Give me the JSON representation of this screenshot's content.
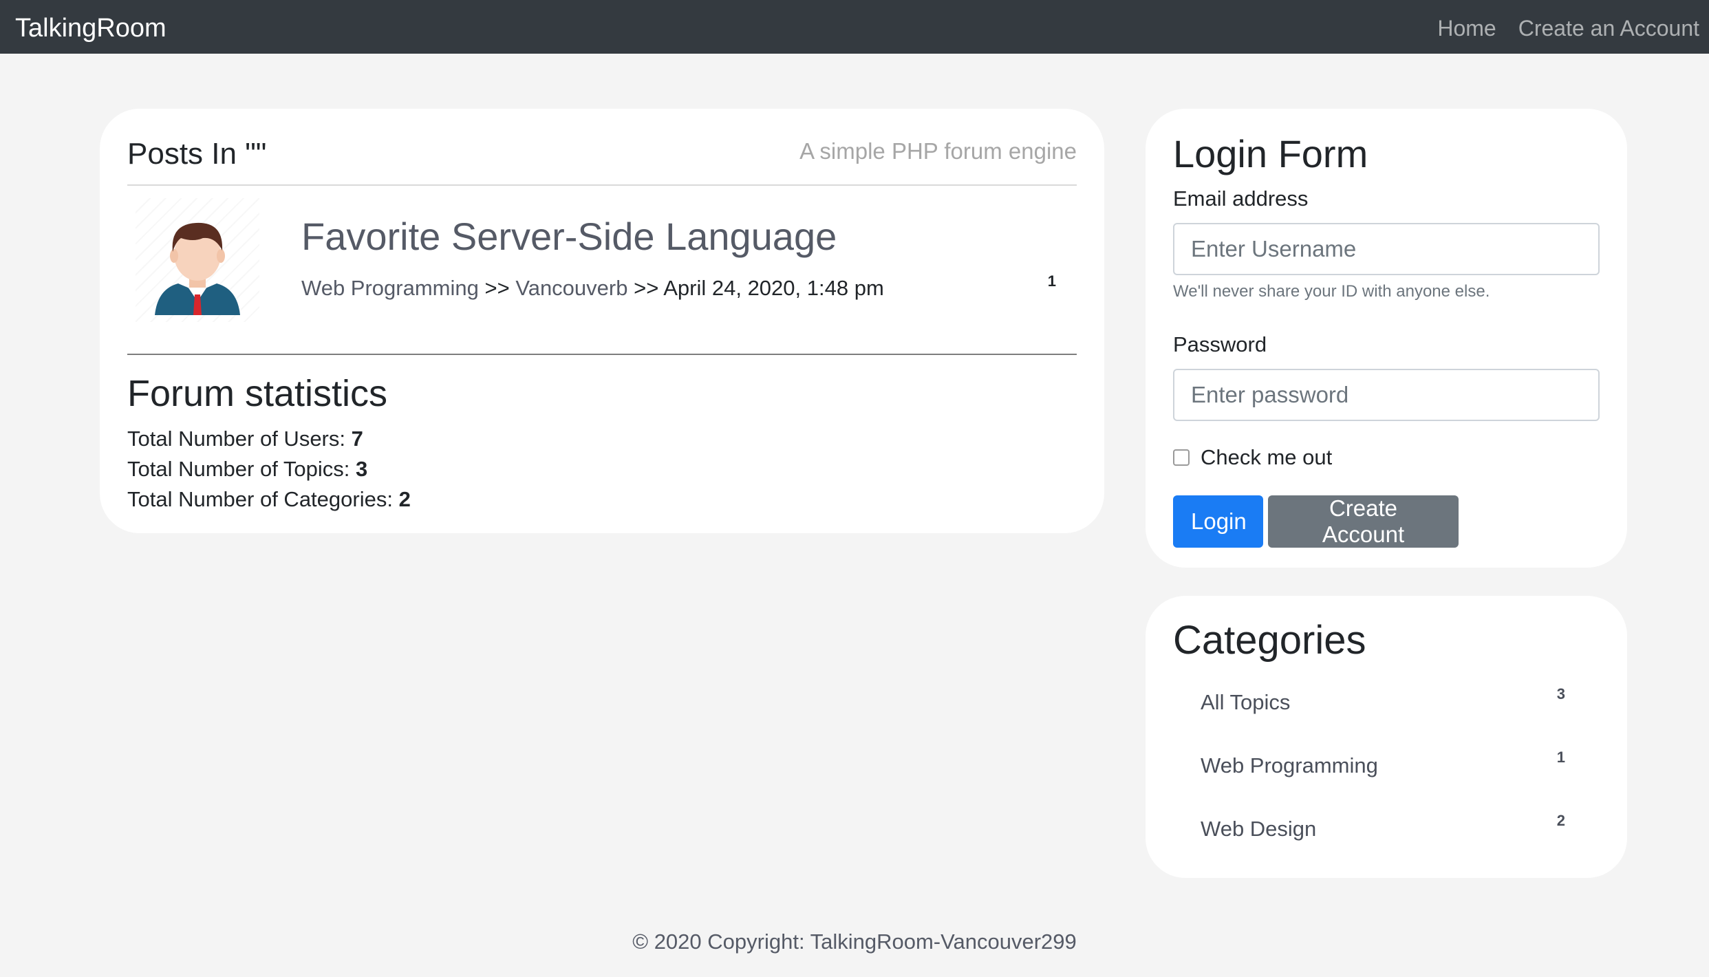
{
  "navbar": {
    "brand": "TalkingRoom",
    "links": [
      "Home",
      "Create an Account"
    ]
  },
  "posts": {
    "title": "Posts In \"\"",
    "subtitle": "A simple PHP forum engine",
    "items": [
      {
        "title": "Favorite Server-Side Language",
        "category": "Web Programming",
        "separator": ">>",
        "author": "Vancouverb",
        "date": "April 24, 2020, 1:48 pm",
        "replies": "1"
      }
    ]
  },
  "stats": {
    "title": "Forum statistics",
    "users_label": "Total Number of Users: ",
    "users_value": "7",
    "topics_label": "Total Number of Topics: ",
    "topics_value": "3",
    "categories_label": "Total Number of Categories: ",
    "categories_value": "2"
  },
  "login": {
    "title": "Login Form",
    "email_label": "Email address",
    "email_placeholder": "Enter Username",
    "email_help": "We'll never share your ID with anyone else.",
    "password_label": "Password",
    "password_placeholder": "Enter password",
    "remember_label": "Check me out",
    "login_button": "Login",
    "create_button": "Create Account"
  },
  "categories": {
    "title": "Categories",
    "items": [
      {
        "label": "All Topics",
        "count": "3"
      },
      {
        "label": "Web Programming",
        "count": "1"
      },
      {
        "label": "Web Design",
        "count": "2"
      }
    ]
  },
  "footer": {
    "copyright": "© 2020 Copyright: TalkingRoom-Vancouver299"
  },
  "colors": {
    "navbar": "#343a40",
    "primary": "#1a7cf4",
    "secondary": "#6c757d",
    "background": "#f4f4f4"
  }
}
